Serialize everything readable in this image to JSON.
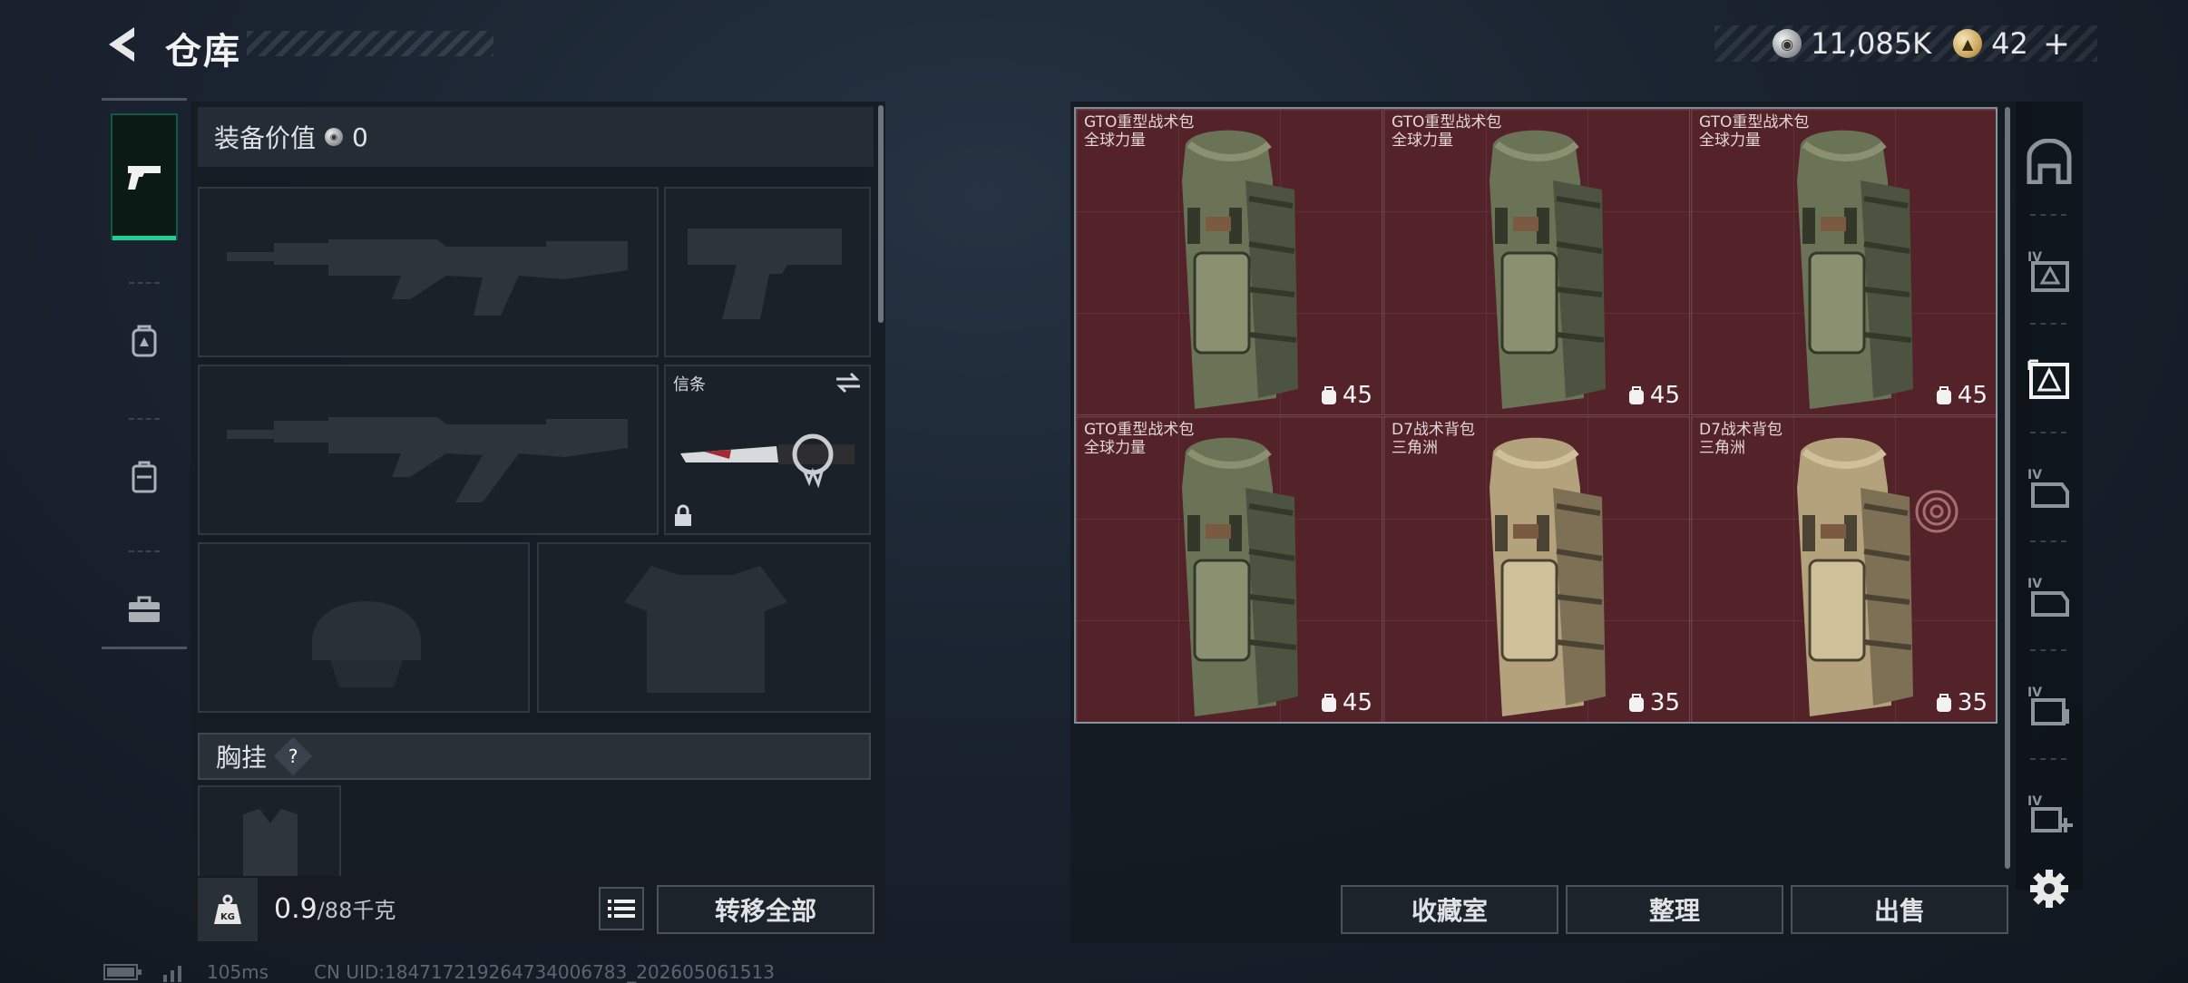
{
  "header": {
    "title": "仓库",
    "back_icon": "back-arrow-icon",
    "currency": {
      "silver_value": "11,085K",
      "gold_value": "42",
      "add_label": "+"
    }
  },
  "left_sidebar": {
    "tabs": [
      {
        "icon": "pistol-icon",
        "active": true
      },
      {
        "icon": "backpack-icon",
        "active": false
      },
      {
        "icon": "luggage-icon",
        "active": false
      },
      {
        "icon": "toolbox-icon",
        "active": false
      }
    ]
  },
  "equipment": {
    "value_label": "装备价值",
    "value": "0",
    "slots": {
      "primary_1": "rifle-slot",
      "pistol": "pistol-slot",
      "primary_2": "rifle-slot",
      "melee_label": "信条",
      "helmet": "helmet-slot",
      "armor": "armor-slot"
    },
    "chest_label": "胸挂",
    "chest_help": "?",
    "weight_value": "0.9",
    "weight_max": "/88",
    "weight_unit": "千克",
    "kg_label": "KG",
    "transfer_all_label": "转移全部"
  },
  "storage": {
    "items": [
      {
        "name": "GTO重型战术包",
        "sub": "全球力量",
        "capacity": "45",
        "variant": "green"
      },
      {
        "name": "GTO重型战术包",
        "sub": "全球力量",
        "capacity": "45",
        "variant": "green"
      },
      {
        "name": "GTO重型战术包",
        "sub": "全球力量",
        "capacity": "45",
        "variant": "green"
      },
      {
        "name": "GTO重型战术包",
        "sub": "全球力量",
        "capacity": "45",
        "variant": "green"
      },
      {
        "name": "D7战术背包",
        "sub": "三角洲",
        "capacity": "35",
        "variant": "tan"
      },
      {
        "name": "D7战术背包",
        "sub": "三角洲",
        "capacity": "35",
        "variant": "tan"
      }
    ],
    "buttons": {
      "collection": "收藏室",
      "organize": "整理",
      "sell": "出售"
    }
  },
  "right_sidebar": {
    "tabs": [
      "armory-icon",
      "storage-iv-icon",
      "storage-active-icon",
      "storage-iv-2-icon",
      "storage-iv-3-icon",
      "storage-iv-4-icon",
      "storage-iv-add-icon"
    ],
    "iv_label": "IV",
    "settings_icon": "gear-icon"
  },
  "status_bar": {
    "ping": "105ms",
    "uid": "CN UID:184717219264734006783_202605061513"
  },
  "colors": {
    "accent": "#1fcf93",
    "grid_bg": "#54232a"
  }
}
